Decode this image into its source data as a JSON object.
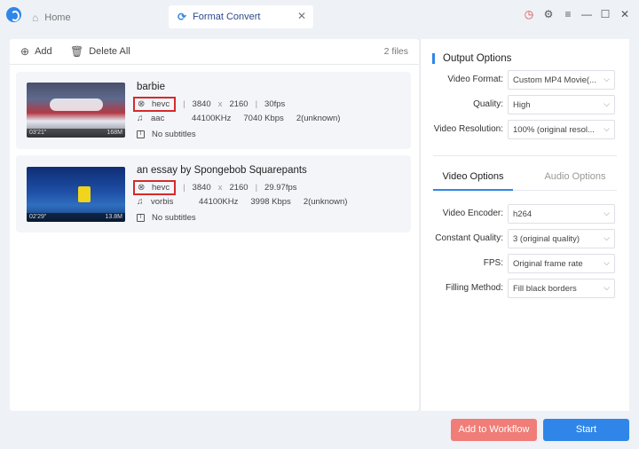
{
  "titlebar": {
    "tabs": [
      {
        "label": "Home",
        "icon": "home-icon"
      },
      {
        "label": "Format Convert",
        "icon": "refresh-icon"
      }
    ],
    "close_glyph": "✕",
    "window_controls": [
      "timer-icon",
      "gear-icon",
      "menu-icon",
      "minimize-icon",
      "maximize-icon",
      "close-icon"
    ]
  },
  "toolbar": {
    "add_label": "Add",
    "delete_all_label": "Delete All",
    "files_count": "2 files"
  },
  "files": [
    {
      "title": "barbie",
      "codec": "hevc",
      "width": "3840",
      "x": "x",
      "height": "2160",
      "fps": "30fps",
      "audio_codec": "aac",
      "sample_rate": "44100KHz",
      "bitrate": "7040 Kbps",
      "channels": "2(unknown)",
      "subtitles": "No subtitles",
      "duration": "03'21\"",
      "size": "168M"
    },
    {
      "title": "an essay by Spongebob Squarepants",
      "codec": "hevc",
      "width": "3840",
      "x": "x",
      "height": "2160",
      "fps": "29.97fps",
      "audio_codec": "vorbis",
      "sample_rate": "44100KHz",
      "bitrate": "3998 Kbps",
      "channels": "2(unknown)",
      "subtitles": "No subtitles",
      "duration": "02'29\"",
      "size": "13.8M"
    }
  ],
  "output_options": {
    "title": "Output Options",
    "video_format_label": "Video Format:",
    "video_format_value": "Custom MP4 Movie(...",
    "quality_label": "Quality:",
    "quality_value": "High",
    "resolution_label": "Video Resolution:",
    "resolution_value": "100% (original resol..."
  },
  "subtabs": {
    "video": "Video Options",
    "audio": "Audio Options"
  },
  "video_options": {
    "encoder_label": "Video Encoder:",
    "encoder_value": "h264",
    "constant_quality_label": "Constant Quality:",
    "constant_quality_value": "3 (original quality)",
    "fps_label": "FPS:",
    "fps_value": "Original frame rate",
    "filling_label": "Filling Method:",
    "filling_value": "Fill black borders"
  },
  "buttons": {
    "workflow": "Add to Workflow",
    "start": "Start"
  },
  "colors": {
    "accent": "#2f86e8",
    "workflow_button": "#f07d77",
    "highlight_box": "#d62b2b"
  }
}
